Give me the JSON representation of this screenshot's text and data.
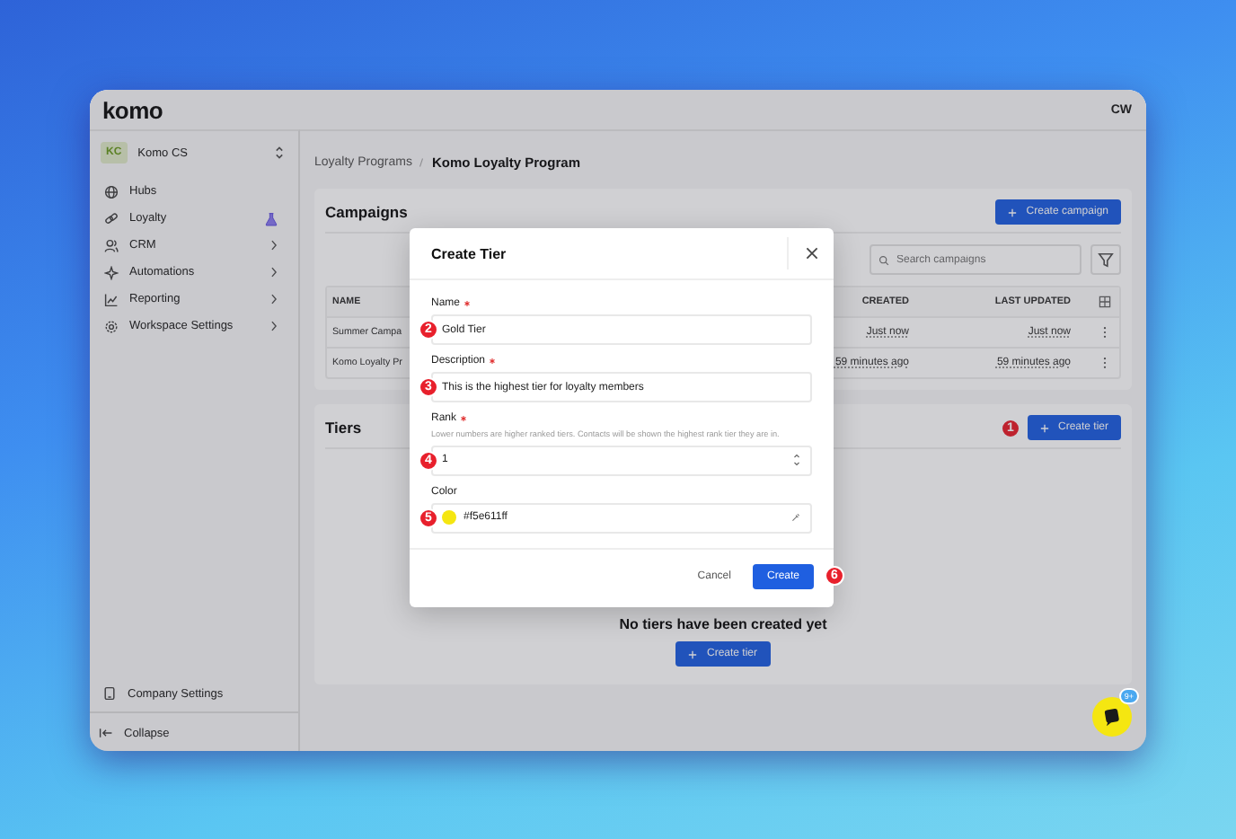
{
  "topbar": {
    "logo": "komo",
    "user_initials": "CW"
  },
  "workspace": {
    "initials": "KC",
    "name": "Komo CS"
  },
  "sidebar": {
    "items": [
      {
        "label": "Hubs",
        "kind": "globe",
        "has_submenu": false,
        "beta": false
      },
      {
        "label": "Loyalty",
        "kind": "link",
        "has_submenu": false,
        "beta": true
      },
      {
        "label": "CRM",
        "kind": "users",
        "has_submenu": true,
        "beta": false
      },
      {
        "label": "Automations",
        "kind": "sparkle",
        "has_submenu": true,
        "beta": false
      },
      {
        "label": "Reporting",
        "kind": "chart",
        "has_submenu": true,
        "beta": false
      },
      {
        "label": "Workspace Settings",
        "kind": "gear",
        "has_submenu": true,
        "beta": false
      }
    ],
    "footer": {
      "settings": "Company Settings",
      "collapse": "Collapse"
    }
  },
  "breadcrumb": {
    "parent": "Loyalty Programs",
    "current": "Komo Loyalty Program"
  },
  "campaigns": {
    "title": "Campaigns",
    "create_button": "Create campaign",
    "search": {
      "placeholder": "Search campaigns"
    },
    "columns": [
      "NAME",
      "CREATED",
      "LAST UPDATED"
    ],
    "rows": [
      {
        "name": "Summer Campa",
        "created": "Just now",
        "updated": "Just now"
      },
      {
        "name": "Komo Loyalty Pr",
        "created": "59 minutes ago",
        "updated": "59 minutes ago"
      }
    ]
  },
  "tiers": {
    "title": "Tiers",
    "marker": "1",
    "create_button": "Create tier",
    "empty_text": "No tiers have been created yet",
    "empty_button": "Create tier"
  },
  "modal": {
    "title": "Create Tier",
    "fields": [
      {
        "kind": "text",
        "label": "Name",
        "required": true,
        "value": "Gold Tier",
        "marker": "2"
      },
      {
        "kind": "text",
        "label": "Description",
        "required": true,
        "value": "This is the highest tier for loyalty members",
        "marker": "3"
      },
      {
        "kind": "number",
        "label": "Rank",
        "required": true,
        "hint": "Lower numbers are higher ranked tiers. Contacts will be shown the highest rank tier they are in.",
        "value": "1",
        "marker": "4"
      },
      {
        "kind": "color",
        "label": "Color",
        "required": false,
        "value": "#f5e611ff",
        "color": "#f5e611",
        "marker": "5"
      }
    ],
    "cancel": "Cancel",
    "submit": "Create",
    "submit_marker": "6"
  },
  "help": {
    "badge": "9+"
  }
}
